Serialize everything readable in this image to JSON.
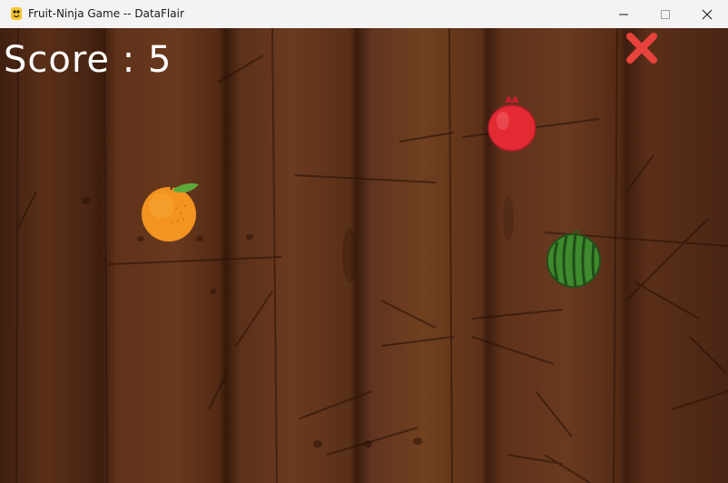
{
  "window": {
    "title": "Fruit-Ninja Game -- DataFlair",
    "app_icon": "pygame-snake-icon",
    "controls": [
      "minimize-icon",
      "maximize-icon",
      "close-icon"
    ]
  },
  "game": {
    "score_text": "Score : 5",
    "lives_icon": "red-x-icon",
    "fruits": [
      "orange",
      "pomegranate",
      "watermelon"
    ],
    "colors": {
      "score": "#ffffff",
      "cross": "#e8423d",
      "orange": "#f39420",
      "pomegranate": "#e32a33",
      "watermelon": "#3f8a2e"
    }
  }
}
